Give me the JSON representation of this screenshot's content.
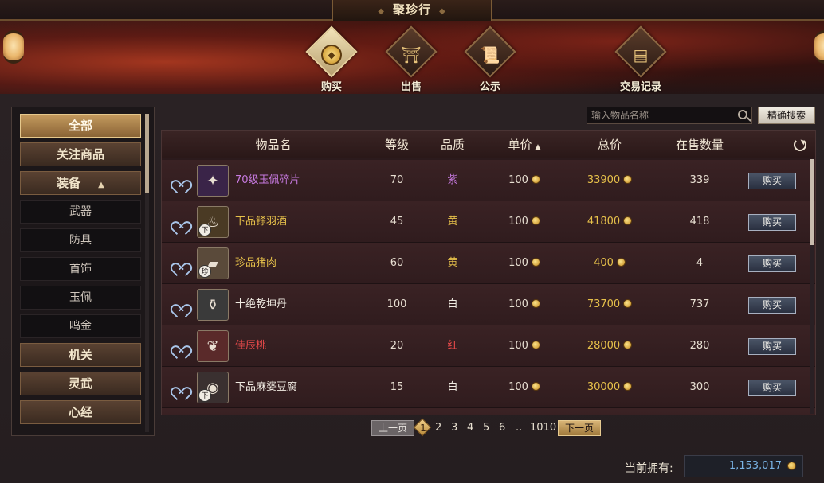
{
  "window": {
    "title": "聚珍行"
  },
  "nav": [
    {
      "label": "购买",
      "icon": "coin-icon",
      "active": true
    },
    {
      "label": "出售",
      "icon": "stall-icon",
      "active": false
    },
    {
      "label": "公示",
      "icon": "scroll-icon",
      "active": false
    },
    {
      "label": "交易记录",
      "icon": "book-icon",
      "active": false
    }
  ],
  "sidebar": {
    "items": [
      {
        "label": "全部",
        "type": "category",
        "active": true
      },
      {
        "label": "关注商品",
        "type": "category",
        "active": false
      },
      {
        "label": "装备",
        "type": "category",
        "expanded": true
      },
      {
        "label": "武器",
        "type": "sub"
      },
      {
        "label": "防具",
        "type": "sub"
      },
      {
        "label": "首饰",
        "type": "sub"
      },
      {
        "label": "玉佩",
        "type": "sub"
      },
      {
        "label": "鸣金",
        "type": "sub"
      },
      {
        "label": "机关",
        "type": "category"
      },
      {
        "label": "灵武",
        "type": "category"
      },
      {
        "label": "心经",
        "type": "category"
      }
    ]
  },
  "search": {
    "placeholder": "输入物品名称",
    "exact_label": "精确搜索"
  },
  "table": {
    "headers": {
      "name": "物品名",
      "level": "等级",
      "quality": "品质",
      "unit_price": "单价",
      "total": "总价",
      "qty": "在售数量"
    },
    "rows": [
      {
        "name": "70级玉佩碎片",
        "level": "70",
        "quality": "紫",
        "unit_price": "100",
        "total": "33900",
        "qty": "339",
        "buy": "购买",
        "name_color": "#c77ae0",
        "quality_color": "#c77ae0",
        "icon": "jade-shard-icon",
        "tier": "",
        "icon_bg": "#3a2448"
      },
      {
        "name": "下品铩羽酒",
        "level": "45",
        "quality": "黄",
        "unit_price": "100",
        "total": "41800",
        "qty": "418",
        "buy": "购买",
        "name_color": "#e6c04a",
        "quality_color": "#e6c04a",
        "icon": "wine-gourd-icon",
        "tier": "下",
        "icon_bg": "#4a3a24"
      },
      {
        "name": "珍品猪肉",
        "level": "60",
        "quality": "黄",
        "unit_price": "100",
        "total": "400",
        "qty": "4",
        "buy": "购买",
        "name_color": "#e6c04a",
        "quality_color": "#e6c04a",
        "icon": "pork-icon",
        "tier": "珍",
        "icon_bg": "#5a4a3a"
      },
      {
        "name": "十绝乾坤丹",
        "level": "100",
        "quality": "白",
        "unit_price": "100",
        "total": "73700",
        "qty": "737",
        "buy": "购买",
        "name_color": "#f0ebe2",
        "quality_color": "#f0ebe2",
        "icon": "pill-bottle-icon",
        "tier": "",
        "icon_bg": "#3a3a3a"
      },
      {
        "name": "佳辰桃",
        "level": "20",
        "quality": "红",
        "unit_price": "100",
        "total": "28000",
        "qty": "280",
        "buy": "购买",
        "name_color": "#e84a4a",
        "quality_color": "#e84a4a",
        "icon": "peach-icon",
        "tier": "",
        "icon_bg": "#5a2a2a"
      },
      {
        "name": "下品麻婆豆腐",
        "level": "15",
        "quality": "白",
        "unit_price": "100",
        "total": "30000",
        "qty": "300",
        "buy": "购买",
        "name_color": "#f0ebe2",
        "quality_color": "#f0ebe2",
        "icon": "tofu-dish-icon",
        "tier": "下",
        "icon_bg": "#3a3030"
      }
    ]
  },
  "pager": {
    "prev": "上一页",
    "next": "下一页",
    "current": "1",
    "pages": [
      "2",
      "3",
      "4",
      "5",
      "6",
      "..",
      "1010"
    ]
  },
  "wallet": {
    "label": "当前拥有:",
    "amount": "1,153,017"
  },
  "colors": {
    "gold": "#e6c04a",
    "accent": "#c49a5e"
  }
}
